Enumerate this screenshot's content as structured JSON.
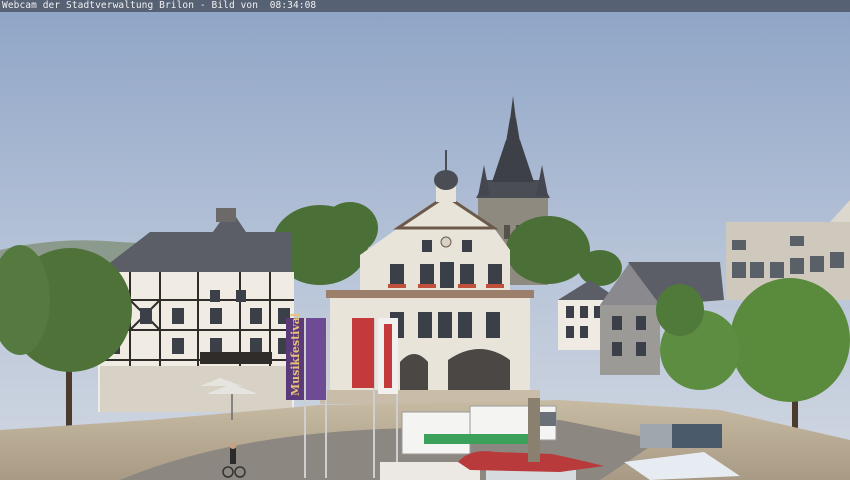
{
  "caption": {
    "text": "Webcam der Stadtverwaltung Brilon - Bild von  08:34:08"
  },
  "banners": {
    "left_banner_text": "Musikfestival"
  },
  "scene": {
    "sky_top_color": "#8ea4c6",
    "sky_bottom_color": "#c9d3e0",
    "town_hall_color": "#e9e4da",
    "roof_color": "#5a5d66",
    "tree_color": "#4f7a3a",
    "plaza_color": "#b9ab94"
  }
}
